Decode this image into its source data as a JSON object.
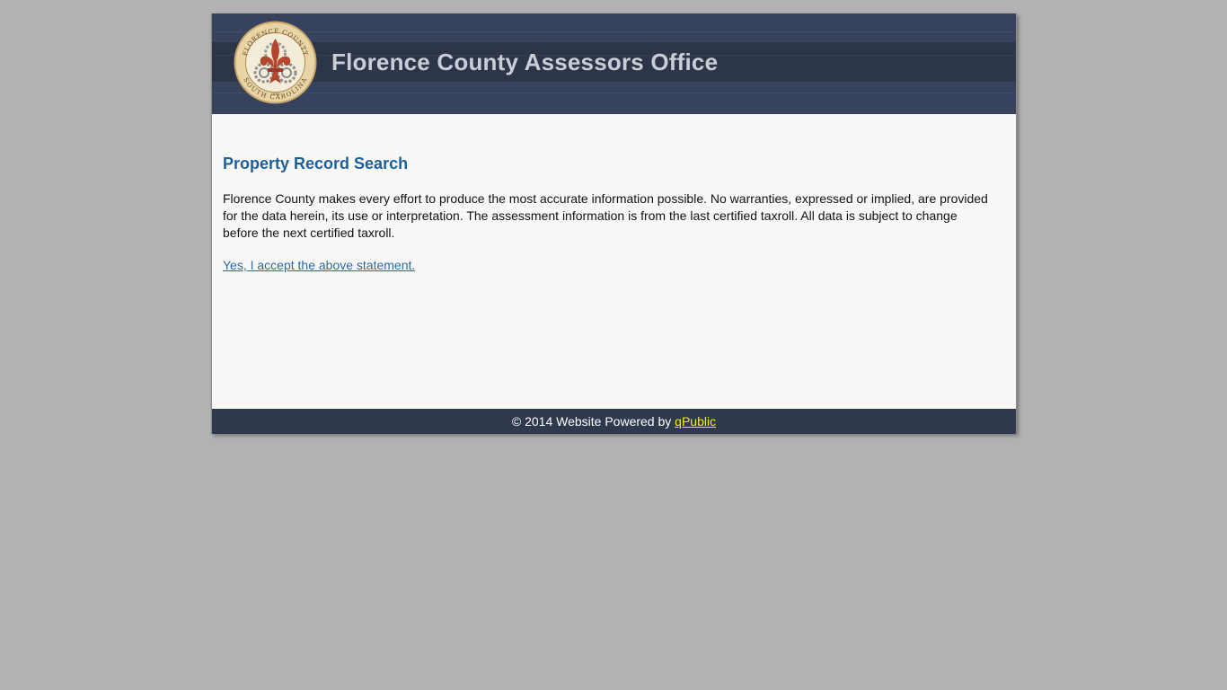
{
  "header": {
    "site_title": "Florence County Assessors Office",
    "seal": {
      "top_text": "FLORENCE COUNTY",
      "bottom_text": "SOUTH CAROLINA",
      "year": "1888"
    }
  },
  "main": {
    "heading": "Property Record Search",
    "notice": "Florence County makes every effort to produce the most accurate information possible. No warranties, expressed or implied, are provided for the data herein, its use or interpretation. The assessment information is from the last certified taxroll. All data is subject to change before the next certified taxroll.",
    "accept_link": "Yes, I accept the above statement."
  },
  "footer": {
    "prefix": "© 2014  Website Powered by ",
    "link_label": "qPublic"
  },
  "colors": {
    "page_background": "#b2b2b2",
    "header_background": "#35415a",
    "footer_background": "#2e394e",
    "heading": "#1f5f99",
    "link": "#2e6a9e",
    "footer_link": "#f2f200"
  }
}
